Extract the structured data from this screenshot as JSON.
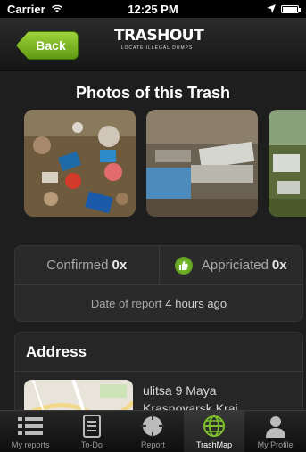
{
  "status": {
    "carrier": "Carrier",
    "time": "12:25 PM"
  },
  "nav": {
    "back_label": "Back",
    "logo_main": "TRASHOUT",
    "logo_sub": "LOCATE ILLEGAL DUMPS"
  },
  "photos": {
    "title": "Photos of this Trash"
  },
  "stats": {
    "confirmed_label": "Confirmed",
    "confirmed_count": "0x",
    "appreciated_label": "Appriciated",
    "appreciated_count": "0x",
    "date_label": "Date of report",
    "date_value": "4 hours ago"
  },
  "address": {
    "title": "Address",
    "line1": "ulitsa 9 Maya",
    "line2": "Krasnoyarsk Krai"
  },
  "tabs": [
    {
      "label": "My reports",
      "icon": "list-icon"
    },
    {
      "label": "To-Do",
      "icon": "notepad-icon"
    },
    {
      "label": "Report",
      "icon": "target-icon"
    },
    {
      "label": "TrashMap",
      "icon": "globe-icon"
    },
    {
      "label": "My Profile",
      "icon": "person-icon"
    }
  ],
  "colors": {
    "accent_green": "#7cbf2a",
    "background": "#1e1e1e"
  }
}
